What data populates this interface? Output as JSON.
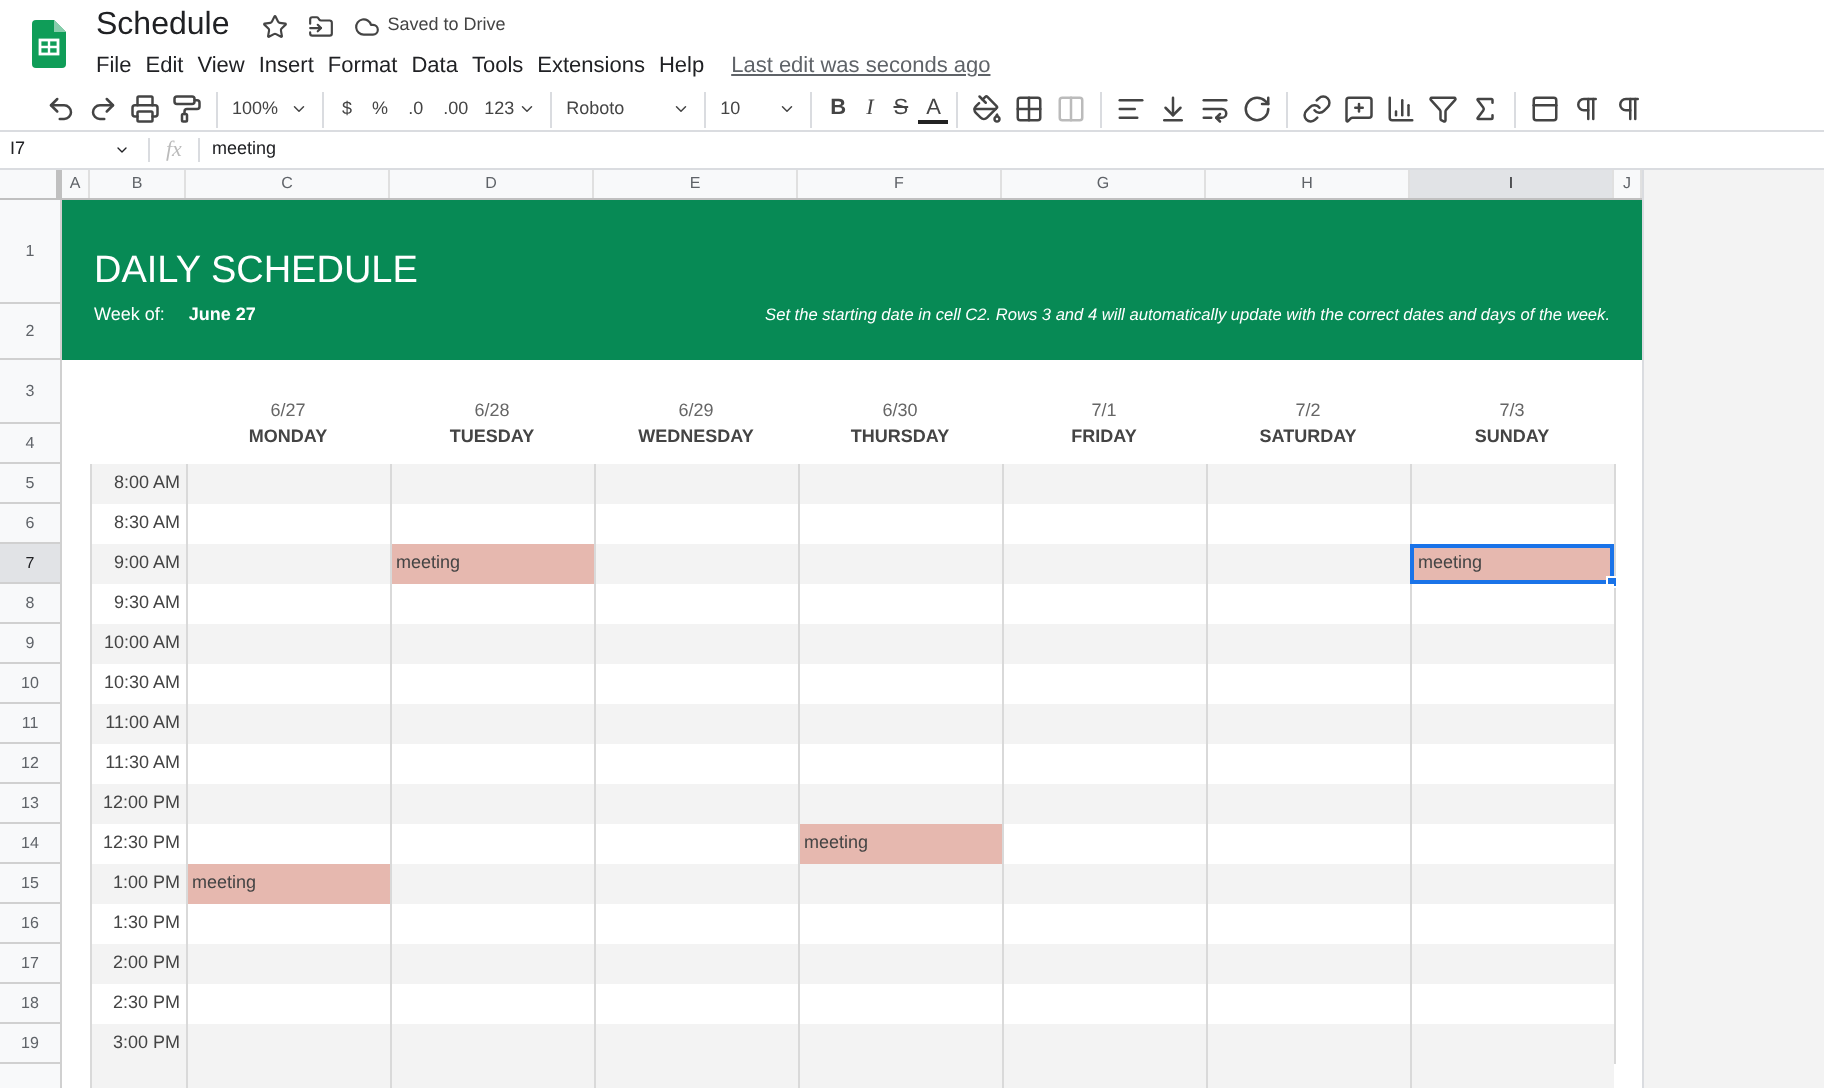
{
  "title": "Schedule",
  "save_status": "Saved to Drive",
  "menu": [
    "File",
    "Edit",
    "View",
    "Insert",
    "Format",
    "Data",
    "Tools",
    "Extensions",
    "Help"
  ],
  "last_edit": "Last edit was seconds ago",
  "toolbar": {
    "zoom": "100%",
    "currency": "$",
    "percent": "%",
    "decrease_decimal": ".0",
    "increase_decimal": ".00",
    "number_format": "123",
    "font": "Roboto",
    "font_size": "10",
    "bold": "B",
    "italic": "I",
    "strikethrough": "S",
    "text_color": "A"
  },
  "name_box": "I7",
  "formula_label": "fx",
  "formula": "meeting",
  "columns": [
    {
      "label": "A",
      "selected": false
    },
    {
      "label": "B",
      "selected": false
    },
    {
      "label": "C",
      "selected": false
    },
    {
      "label": "D",
      "selected": false
    },
    {
      "label": "E",
      "selected": false
    },
    {
      "label": "F",
      "selected": false
    },
    {
      "label": "G",
      "selected": false
    },
    {
      "label": "H",
      "selected": false
    },
    {
      "label": "I",
      "selected": true
    },
    {
      "label": "J",
      "selected": false
    }
  ],
  "banner": {
    "title": "DAILY SCHEDULE",
    "week_label": "Week of:",
    "week_value": "June 27",
    "note": "Set the starting date in cell C2. Rows 3 and 4 will automatically update with the correct dates and days of the week.",
    "row_numbers": [
      "1",
      "2"
    ]
  },
  "day_header_rows": [
    "3",
    "4"
  ],
  "days": [
    {
      "date": "6/27",
      "day": "MONDAY"
    },
    {
      "date": "6/28",
      "day": "TUESDAY"
    },
    {
      "date": "6/29",
      "day": "WEDNESDAY"
    },
    {
      "date": "6/30",
      "day": "THURSDAY"
    },
    {
      "date": "7/1",
      "day": "FRIDAY"
    },
    {
      "date": "7/2",
      "day": "SATURDAY"
    },
    {
      "date": "7/3",
      "day": "SUNDAY"
    }
  ],
  "rows": [
    {
      "number": "5",
      "time": "8:00 AM",
      "selected": false,
      "cells": [
        {
          "selected": false
        },
        {
          "selected": false
        },
        {
          "selected": false
        },
        {
          "selected": false
        },
        {
          "selected": false
        },
        {
          "selected": false
        },
        {
          "selected": false
        }
      ]
    },
    {
      "number": "6",
      "time": "8:30 AM",
      "selected": false,
      "cells": [
        {
          "selected": false
        },
        {
          "selected": false
        },
        {
          "selected": false
        },
        {
          "selected": false
        },
        {
          "selected": false
        },
        {
          "selected": false
        },
        {
          "selected": false
        }
      ]
    },
    {
      "number": "7",
      "time": "9:00 AM",
      "selected": true,
      "cells": [
        {
          "selected": false
        },
        {
          "text": "meeting",
          "selected": false
        },
        {
          "selected": false
        },
        {
          "selected": false
        },
        {
          "selected": false
        },
        {
          "selected": false
        },
        {
          "text": "meeting",
          "selected": true
        }
      ]
    },
    {
      "number": "8",
      "time": "9:30 AM",
      "selected": false,
      "cells": [
        {
          "selected": false
        },
        {
          "selected": false
        },
        {
          "selected": false
        },
        {
          "selected": false
        },
        {
          "selected": false
        },
        {
          "selected": false
        },
        {
          "selected": false
        }
      ]
    },
    {
      "number": "9",
      "time": "10:00 AM",
      "selected": false,
      "cells": [
        {
          "selected": false
        },
        {
          "selected": false
        },
        {
          "selected": false
        },
        {
          "selected": false
        },
        {
          "selected": false
        },
        {
          "selected": false
        },
        {
          "selected": false
        }
      ]
    },
    {
      "number": "10",
      "time": "10:30 AM",
      "selected": false,
      "cells": [
        {
          "selected": false
        },
        {
          "selected": false
        },
        {
          "selected": false
        },
        {
          "selected": false
        },
        {
          "selected": false
        },
        {
          "selected": false
        },
        {
          "selected": false
        }
      ]
    },
    {
      "number": "11",
      "time": "11:00 AM",
      "selected": false,
      "cells": [
        {
          "selected": false
        },
        {
          "selected": false
        },
        {
          "selected": false
        },
        {
          "selected": false
        },
        {
          "selected": false
        },
        {
          "selected": false
        },
        {
          "selected": false
        }
      ]
    },
    {
      "number": "12",
      "time": "11:30 AM",
      "selected": false,
      "cells": [
        {
          "selected": false
        },
        {
          "selected": false
        },
        {
          "selected": false
        },
        {
          "selected": false
        },
        {
          "selected": false
        },
        {
          "selected": false
        },
        {
          "selected": false
        }
      ]
    },
    {
      "number": "13",
      "time": "12:00 PM",
      "selected": false,
      "cells": [
        {
          "selected": false
        },
        {
          "selected": false
        },
        {
          "selected": false
        },
        {
          "selected": false
        },
        {
          "selected": false
        },
        {
          "selected": false
        },
        {
          "selected": false
        }
      ]
    },
    {
      "number": "14",
      "time": "12:30 PM",
      "selected": false,
      "cells": [
        {
          "selected": false
        },
        {
          "selected": false
        },
        {
          "selected": false
        },
        {
          "text": "meeting",
          "selected": false
        },
        {
          "selected": false
        },
        {
          "selected": false
        },
        {
          "selected": false
        }
      ]
    },
    {
      "number": "15",
      "time": "1:00 PM",
      "selected": false,
      "cells": [
        {
          "text": "meeting",
          "selected": false
        },
        {
          "selected": false
        },
        {
          "selected": false
        },
        {
          "selected": false
        },
        {
          "selected": false
        },
        {
          "selected": false
        },
        {
          "selected": false
        }
      ]
    },
    {
      "number": "16",
      "time": "1:30 PM",
      "selected": false,
      "cells": [
        {
          "selected": false
        },
        {
          "selected": false
        },
        {
          "selected": false
        },
        {
          "selected": false
        },
        {
          "selected": false
        },
        {
          "selected": false
        },
        {
          "selected": false
        }
      ]
    },
    {
      "number": "17",
      "time": "2:00 PM",
      "selected": false,
      "cells": [
        {
          "selected": false
        },
        {
          "selected": false
        },
        {
          "selected": false
        },
        {
          "selected": false
        },
        {
          "selected": false
        },
        {
          "selected": false
        },
        {
          "selected": false
        }
      ]
    },
    {
      "number": "18",
      "time": "2:30 PM",
      "selected": false,
      "cells": [
        {
          "selected": false
        },
        {
          "selected": false
        },
        {
          "selected": false
        },
        {
          "selected": false
        },
        {
          "selected": false
        },
        {
          "selected": false
        },
        {
          "selected": false
        }
      ]
    },
    {
      "number": "19",
      "time": "3:00 PM",
      "selected": false,
      "cells": [
        {
          "selected": false
        },
        {
          "selected": false
        },
        {
          "selected": false
        },
        {
          "selected": false
        },
        {
          "selected": false
        },
        {
          "selected": false
        },
        {
          "selected": false
        }
      ]
    }
  ]
}
